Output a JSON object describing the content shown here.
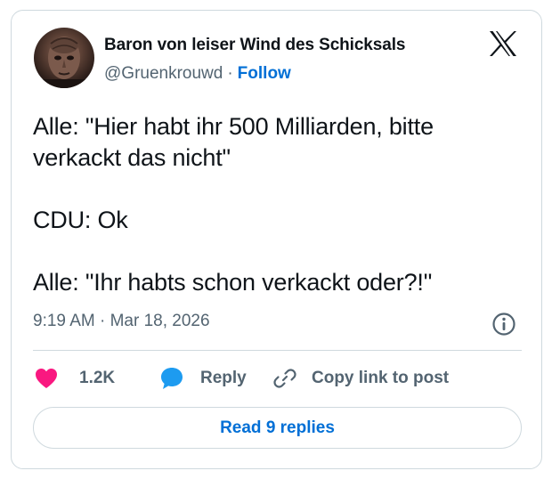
{
  "author": {
    "name": "Baron von leiser Wind des Schicksals",
    "handle": "@Gruenkrouwd",
    "separator": "·",
    "follow_label": "Follow"
  },
  "tweet": {
    "lines": [
      "Alle: \"Hier habt ihr 500 Milliarden, bitte",
      "verkackt das nicht\"",
      "CDU: Ok",
      "Alle: \"Ihr habts schon verkackt oder?!\""
    ],
    "timestamp": "9:19 AM · Mar 18, 2026"
  },
  "actions": {
    "likes": "1.2K",
    "reply_label": "Reply",
    "copy_label": "Copy link to post"
  },
  "footer": {
    "read_replies_label": "Read 9 replies"
  },
  "colors": {
    "heart": "#f91880",
    "reply_bubble": "#1d9bf0",
    "link_blue": "#006fd6",
    "muted": "#536471",
    "border": "#cfd9de"
  },
  "icons": [
    "x-logo-icon",
    "info-icon",
    "heart-icon",
    "reply-bubble-icon",
    "link-icon"
  ]
}
